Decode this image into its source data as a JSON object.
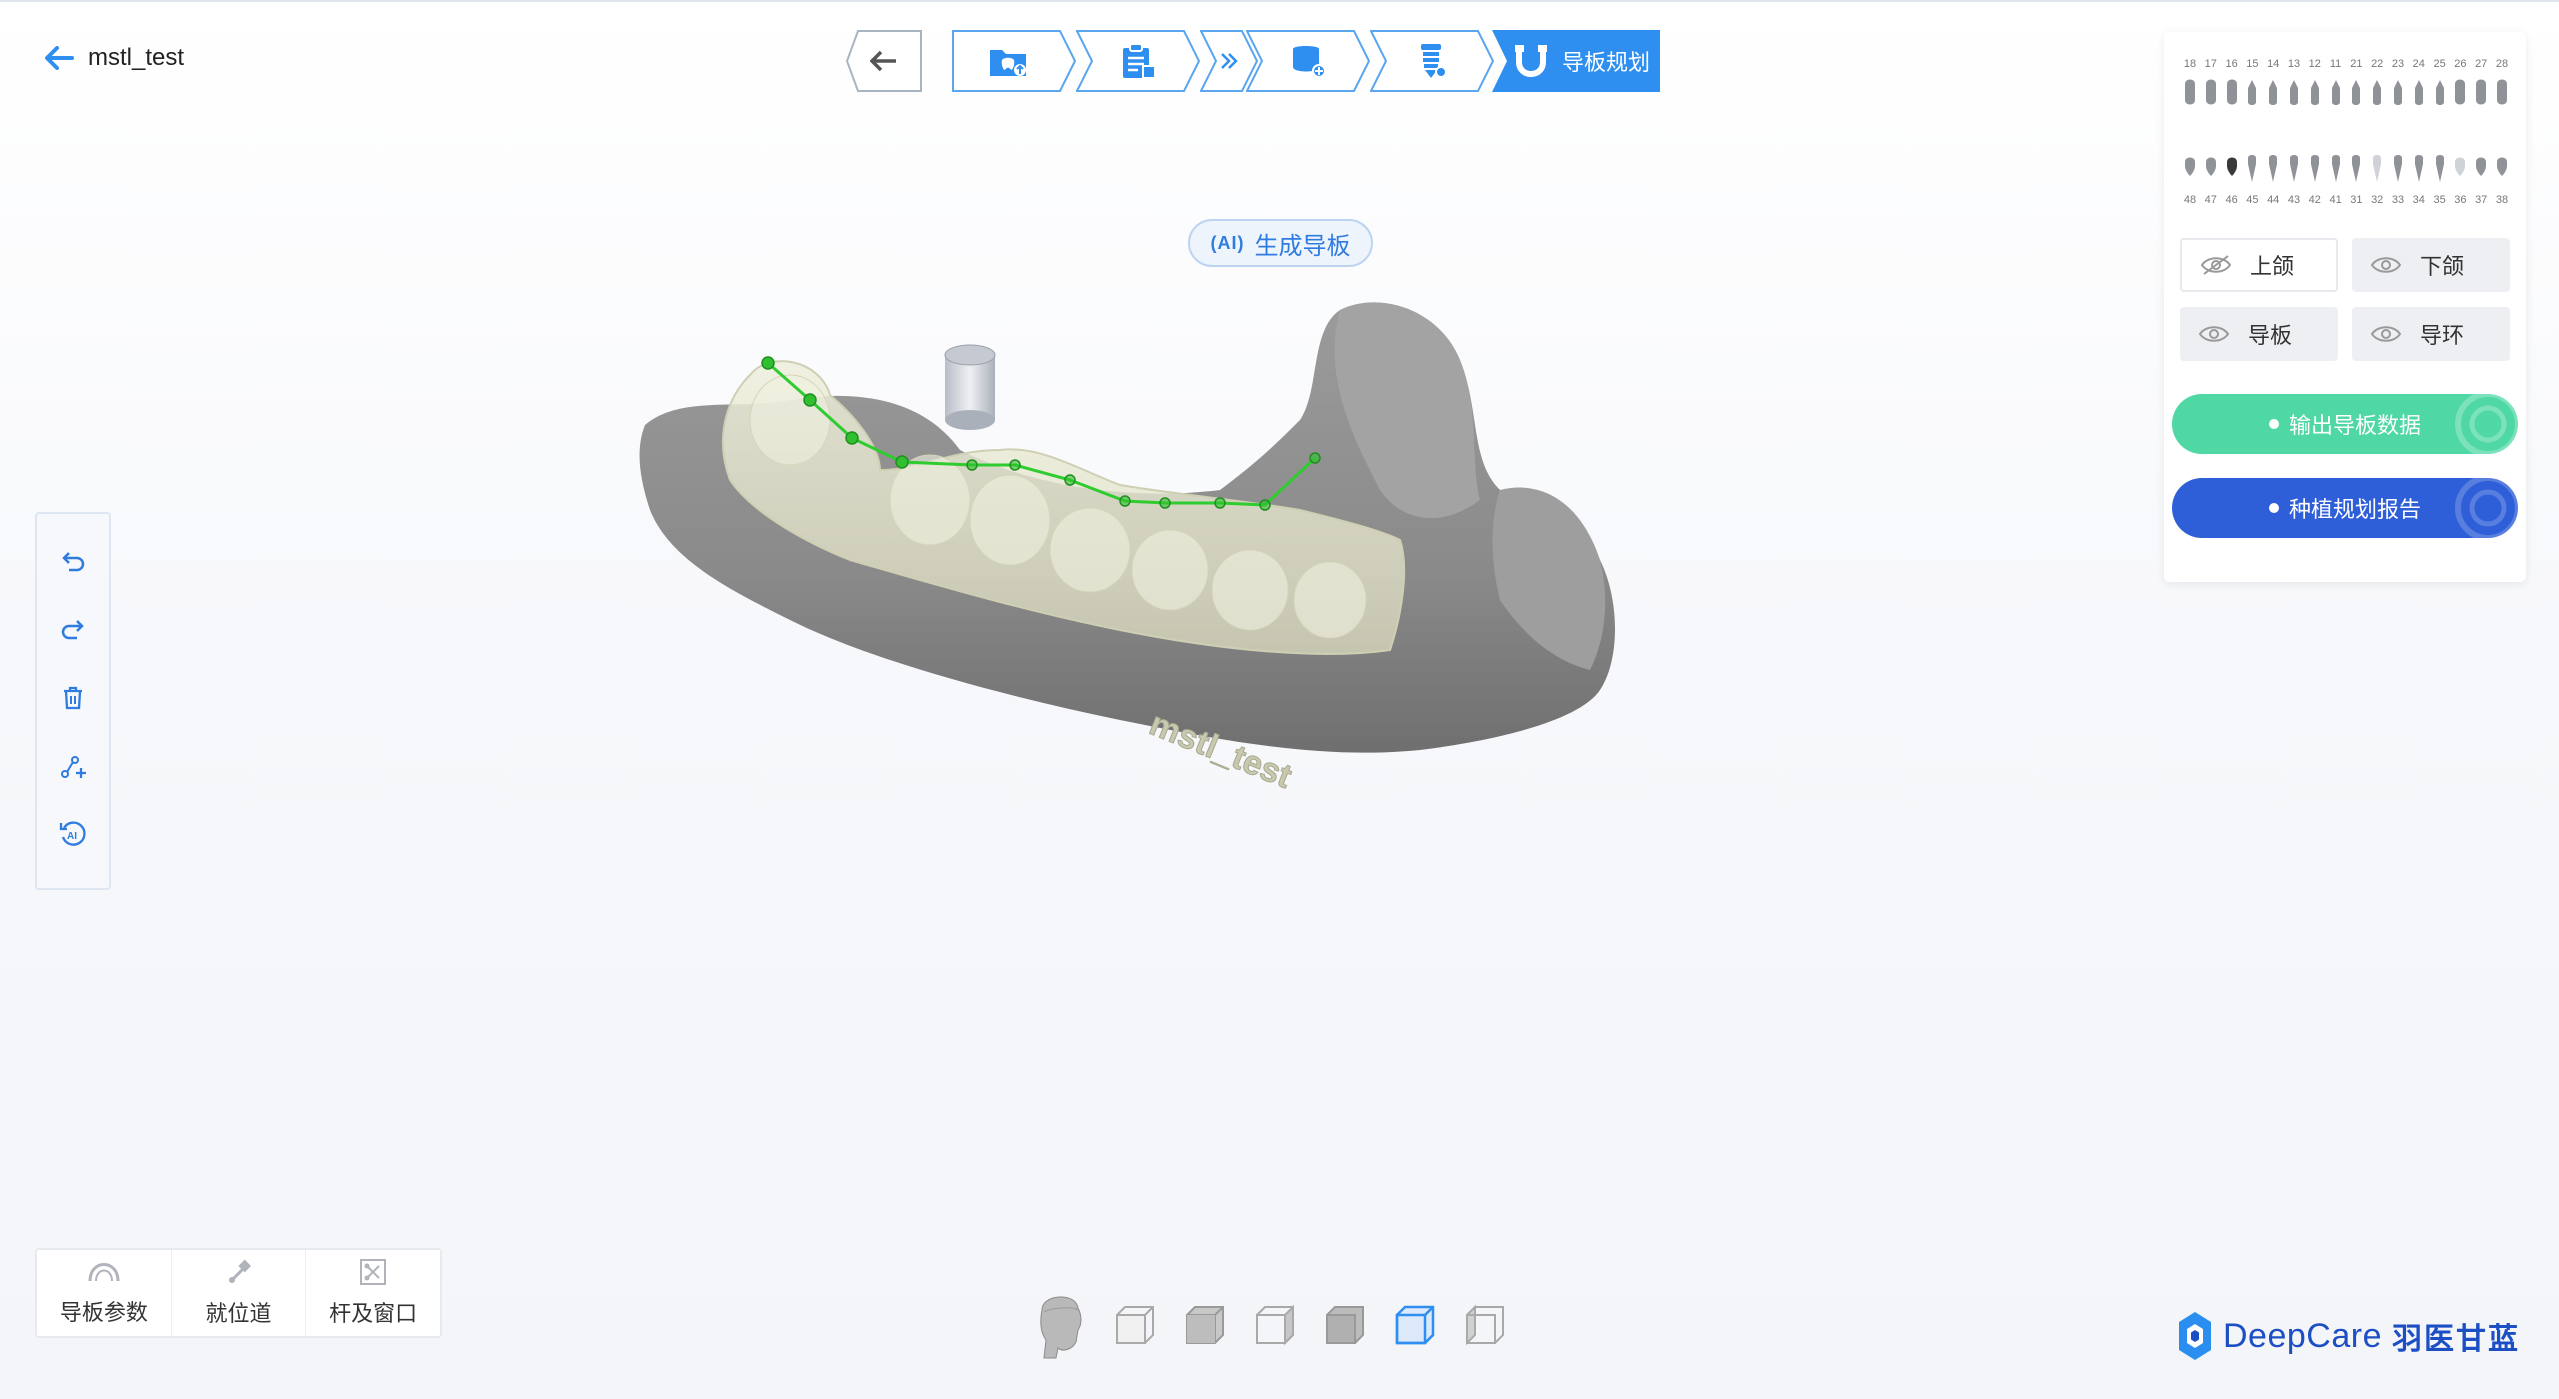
{
  "project": {
    "name": "mstl_test"
  },
  "steps": [
    {
      "icon": "back-arrow-icon"
    },
    {
      "icon": "upload-scan-icon"
    },
    {
      "icon": "clipboard-list-icon"
    },
    {
      "icon": "double-chevron-icon"
    },
    {
      "icon": "tooth-add-icon"
    },
    {
      "icon": "implant-icon"
    },
    {
      "icon": "guide-magnet-icon",
      "label": "导板规划",
      "active": true
    }
  ],
  "ai_button": {
    "tag": "AI",
    "label": "生成导板"
  },
  "left_tools": [
    "undo-icon",
    "redo-icon",
    "delete-icon",
    "add-point-icon",
    "ai-reset-icon"
  ],
  "bottom_tools": [
    {
      "icon": "guide-params-icon",
      "label": "导板参数"
    },
    {
      "icon": "seat-path-icon",
      "label": "就位道"
    },
    {
      "icon": "rod-window-icon",
      "label": "杆及窗口"
    }
  ],
  "views": [
    "head-view",
    "front-view",
    "top-view",
    "right-view",
    "back-view",
    "bottom-view",
    "left-view"
  ],
  "tooth_chart": {
    "upper": [
      "18",
      "17",
      "16",
      "15",
      "14",
      "13",
      "12",
      "11",
      "21",
      "22",
      "23",
      "24",
      "25",
      "26",
      "27",
      "28"
    ],
    "lower": [
      "48",
      "47",
      "46",
      "45",
      "44",
      "43",
      "42",
      "41",
      "31",
      "32",
      "33",
      "34",
      "35",
      "36",
      "37",
      "38"
    ]
  },
  "visibility": [
    {
      "label": "上颌",
      "state": "hidden"
    },
    {
      "label": "下颌",
      "state": "visible"
    },
    {
      "label": "导板",
      "state": "visible"
    },
    {
      "label": "导环",
      "state": "visible"
    }
  ],
  "actions": {
    "export": "输出导板数据",
    "report": "种植规划报告"
  },
  "brand": {
    "name": "DeepCare",
    "cn": "羽医甘蓝"
  },
  "model_label": "mstl_test",
  "colors": {
    "accent": "#2f7be0",
    "step_active": "#2f8ff0",
    "green": "#4fd8a4",
    "blue": "#2f5fd8"
  }
}
